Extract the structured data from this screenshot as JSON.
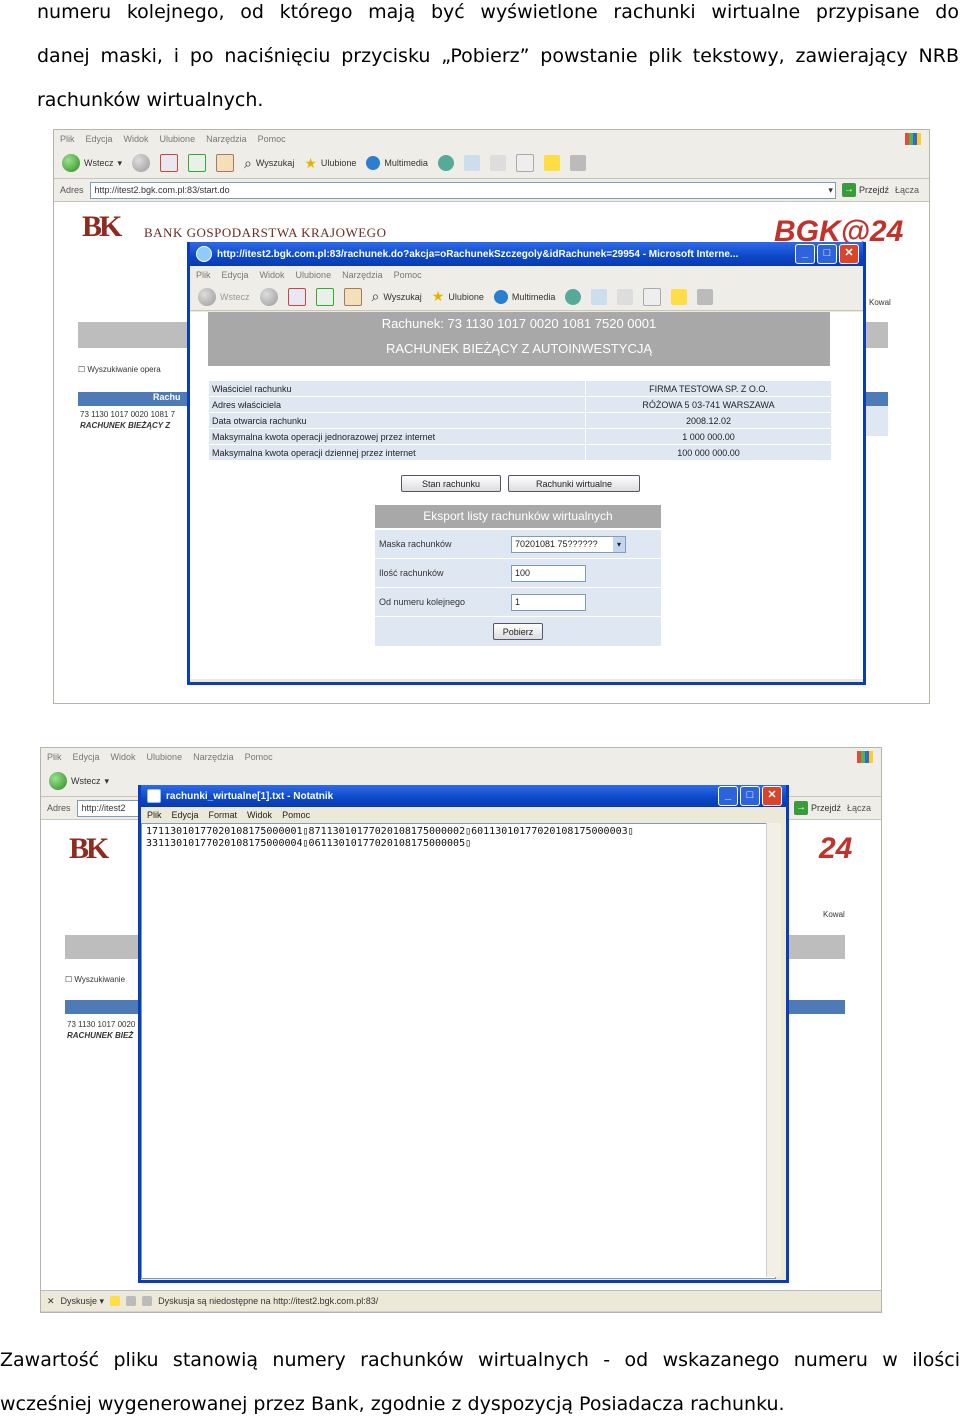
{
  "intro_paragraph": {
    "line1": "numeru kolejnego, od którego mają być wyświetlone rachunki wirtualne przypisane do",
    "line2": "danej maski, i po naciśnięciu przycisku „Pobierz” powstanie plik tekstowy, zawierający NRB",
    "line3": "rachunków wirtualnych."
  },
  "screenshot1": {
    "menu": [
      "Plik",
      "Edycja",
      "Widok",
      "Ulubione",
      "Narzędzia",
      "Pomoc"
    ],
    "toolbar": {
      "back": "Wstecz",
      "search": "Wyszukaj",
      "favorites": "Ulubione",
      "media": "Multimedia"
    },
    "address_label": "Adres",
    "address": "http://itest2.bgk.com.pl:83/start.do",
    "go_label": "Przejdź",
    "links_label": "Łącza",
    "bank_name": "BANK GOSPODARSTWA KRAJOWEGO",
    "brand": "BGK@24",
    "side": {
      "search": "Wyszukiwanie opera",
      "col_header": "Rachu",
      "account": "73 1130 1017 0020 1081 7",
      "account_type": "RACHUNEK BIEŻĄCY Z",
      "right_label": "Kowal"
    },
    "popup": {
      "title": "http://itest2.bgk.com.pl:83/rachunek.do?akcja=oRachunekSzczegoly&idRachunek=29954 - Microsoft Interne...",
      "menu": [
        "Plik",
        "Edycja",
        "Widok",
        "Ulubione",
        "Narzędzia",
        "Pomoc"
      ],
      "toolbar": {
        "back": "Wstecz",
        "search": "Wyszukaj",
        "favorites": "Ulubione",
        "media": "Multimedia"
      },
      "account_header": "Rachunek: 73 1130 1017 0020 1081 7520 0001",
      "account_type": "RACHUNEK BIEŻĄCY Z AUTOINWESTYCJĄ",
      "details": [
        {
          "label": "Właściciel rachunku",
          "value": "FIRMA TESTOWA SP. Z O.O."
        },
        {
          "label": "Adres właściciela",
          "value": "RÓŻOWA 5 03-741 WARSZAWA"
        },
        {
          "label": "Data otwarcia rachunku",
          "value": "2008.12.02"
        },
        {
          "label": "Maksymalna kwota operacji jednorazowej przez internet",
          "value": "1 000 000.00"
        },
        {
          "label": "Maksymalna kwota operacji dziennej przez internet",
          "value": "100 000 000.00"
        }
      ],
      "btn_balance": "Stan rachunku",
      "btn_virtual": "Rachunki wirtualne",
      "export_header": "Eksport listy rachunków wirtualnych",
      "mask_label": "Maska rachunków",
      "mask_value": "70201081 75??????",
      "count_label": "Ilość rachunków",
      "count_value": "100",
      "from_label": "Od numeru kolejnego",
      "from_value": "1",
      "submit": "Pobierz"
    }
  },
  "screenshot2": {
    "menu": [
      "Plik",
      "Edycja",
      "Widok",
      "Ulubione",
      "Narzędzia",
      "Pomoc"
    ],
    "back": "Wstecz",
    "address_label": "Adres",
    "address": "http://itest2",
    "go_label": "Przejdź",
    "links_label": "Łącza",
    "right_label": "Kowal",
    "side": {
      "search": "Wyszukiwanie",
      "account": "73 1130 1017 0020",
      "account_type": "RACHUNEK BIEŻ"
    },
    "notepad": {
      "title": "rachunki_wirtualne[1].txt - Notatnik",
      "menu": [
        "Plik",
        "Edycja",
        "Format",
        "Widok",
        "Pomoc"
      ],
      "line1": "17113010177020108175000001▯87113010177020108175000002▯60113010177020108175000003▯",
      "line2": "33113010177020108175000004▯06113010177020108175000005▯"
    },
    "status": {
      "connect": "Dyskusje ▾",
      "message": "Dyskusja są niedostępne na http://itest2.bgk.com.pl:83/"
    }
  },
  "outro_paragraph": {
    "line1": "Zawartość pliku stanowią numery rachunków wirtualnych -  od wskazanego numeru w ilości",
    "line2": "wcześniej wygenerowanej przez Bank, zgodnie z dyspozycją Posiadacza rachunku."
  }
}
